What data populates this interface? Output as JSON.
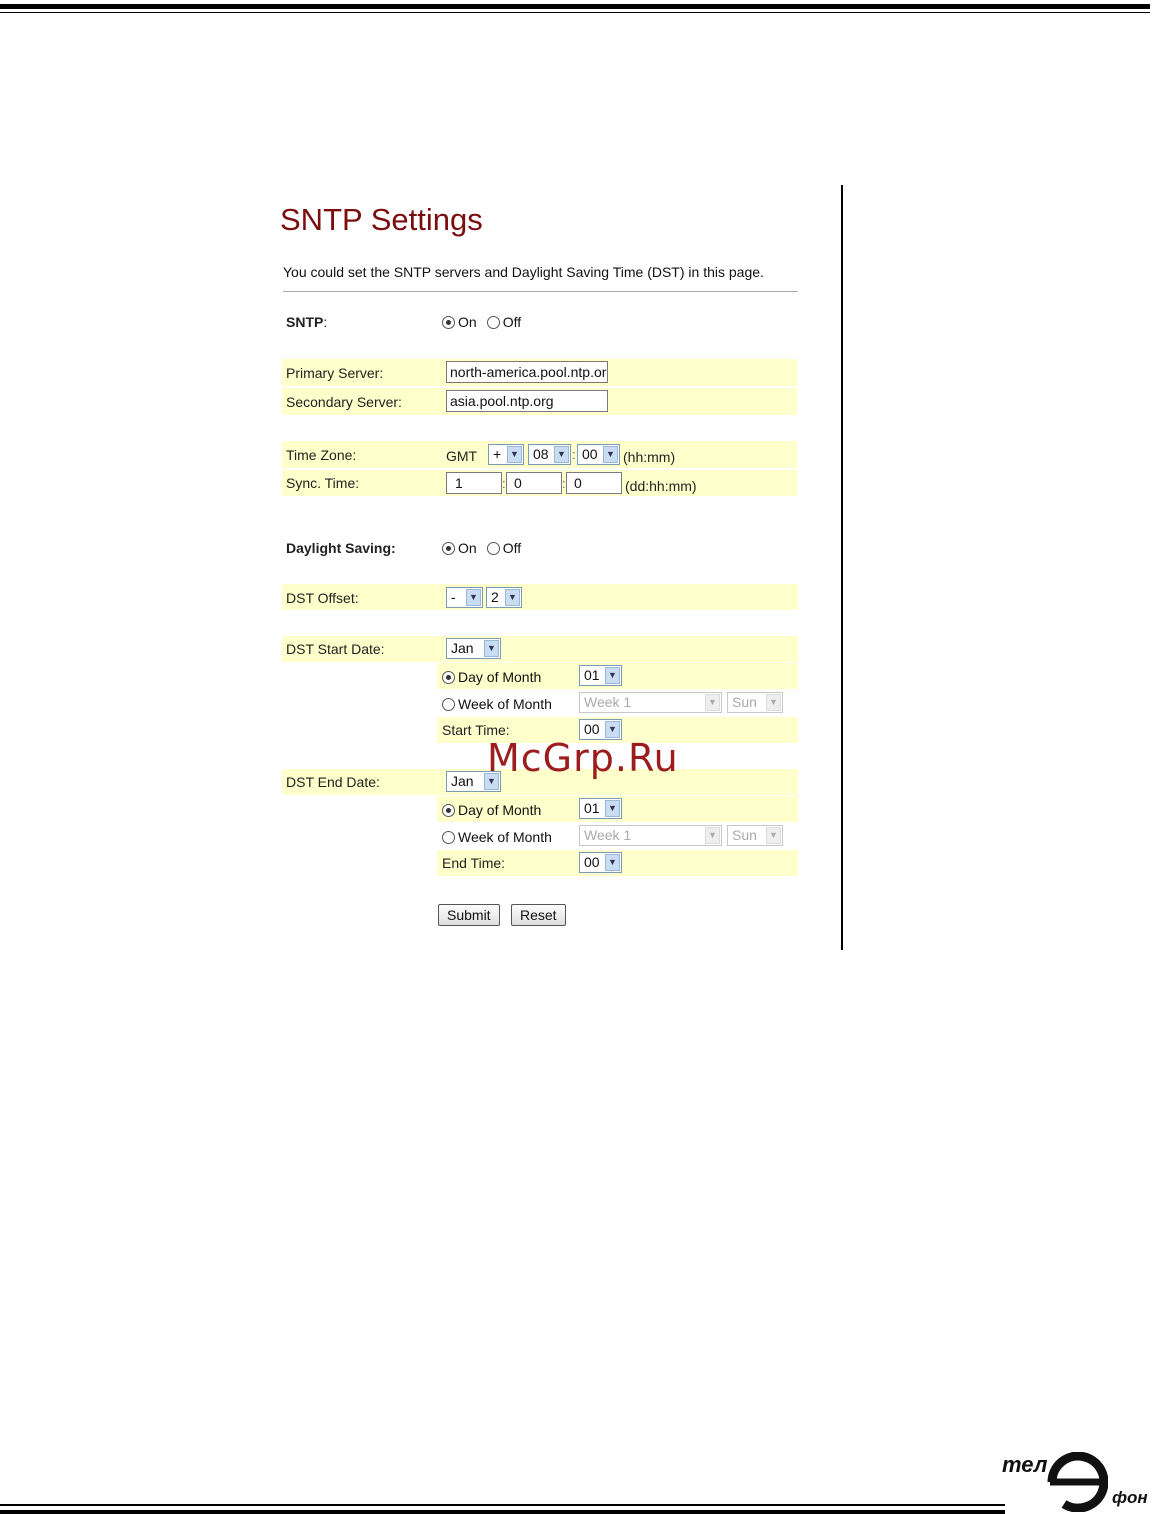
{
  "page": {
    "title": "SNTP Settings",
    "intro": "You could set the SNTP servers and Daylight Saving Time (DST) in this page."
  },
  "sntp": {
    "label_bold": "SNTP",
    "label_suffix": ":",
    "on_label": "On",
    "off_label": "Off",
    "selected": "On"
  },
  "servers": {
    "primary_label": "Primary Server:",
    "primary_value": "north-america.pool.ntp.org",
    "secondary_label": "Secondary Server:",
    "secondary_value": "asia.pool.ntp.org"
  },
  "timezone": {
    "label": "Time Zone:",
    "prefix": "GMT",
    "sign": "+",
    "hours": "08",
    "minutes": "00",
    "separator": ":",
    "unit": "(hh:mm)"
  },
  "sync": {
    "label": "Sync. Time:",
    "days": "1",
    "hours": "0",
    "minutes": "0",
    "separator": ":",
    "unit": "(dd:hh:mm)"
  },
  "daylight": {
    "label": "Daylight Saving:",
    "on_label": "On",
    "off_label": "Off",
    "selected": "On"
  },
  "dst_offset": {
    "label": "DST Offset:",
    "sign": "-",
    "value": "2"
  },
  "dst_start": {
    "label": "DST Start Date:",
    "month": "Jan",
    "day_of_month_label": "Day of Month",
    "day_value": "01",
    "week_of_month_label": "Week of Month",
    "week_value": "Week 1",
    "weekday_value": "Sun",
    "time_label": "Start Time:",
    "time_value": "00",
    "selected_mode": "Day of Month"
  },
  "dst_end": {
    "label": "DST End Date:",
    "month": "Jan",
    "day_of_month_label": "Day of Month",
    "day_value": "01",
    "week_of_month_label": "Week of Month",
    "week_value": "Week 1",
    "weekday_value": "Sun",
    "time_label": "End Time:",
    "time_value": "00",
    "selected_mode": "Day of Month"
  },
  "buttons": {
    "submit": "Submit",
    "reset": "Reset"
  },
  "watermark": "McGrp.Ru",
  "logo": {
    "top": "тел",
    "bottom": "фон"
  },
  "colors": {
    "title": "#7a0e0e",
    "band": "#ffffcc",
    "watermark": "#9b1d1d"
  }
}
